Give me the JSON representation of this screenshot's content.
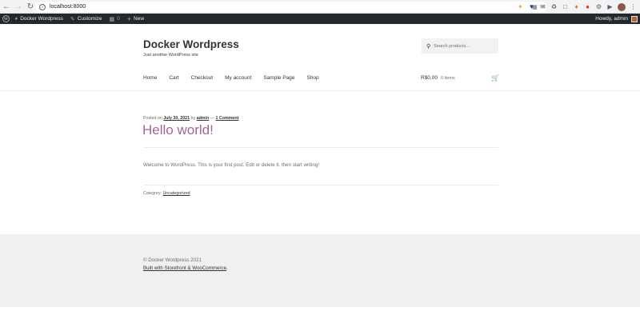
{
  "browser": {
    "url": "localhost:8000",
    "back_icon": "arrow-left-icon",
    "forward_icon": "arrow-right-icon",
    "reload_icon": "reload-icon"
  },
  "admin_bar": {
    "site_name": "Docker Wordpress",
    "customize": "Customize",
    "comments_count": "0",
    "new_label": "New",
    "howdy": "Howdy, admin"
  },
  "header": {
    "site_title": "Docker Wordpress",
    "tagline": "Just another WordPress site",
    "search_placeholder": "Search products…"
  },
  "menu": {
    "items": [
      "Home",
      "Cart",
      "Checkout",
      "My account",
      "Sample Page",
      "Shop"
    ]
  },
  "cart": {
    "amount": "R$0,00",
    "items": "0 items"
  },
  "post": {
    "posted_on_label": "Posted on",
    "date": "July 30, 2021",
    "by_label": "by",
    "author": "admin",
    "separator": "—",
    "comments": "1 Comment",
    "title": "Hello world!",
    "body": "Welcome to WordPress. This is your first post. Edit or delete it, then start writing!",
    "category_label": "Category:",
    "category": "Uncategorized"
  },
  "footer": {
    "copyright": "© Docker Wordpress 2021",
    "built_with": "Built with Storefront & WooCommerce",
    "built_suffix": "."
  }
}
